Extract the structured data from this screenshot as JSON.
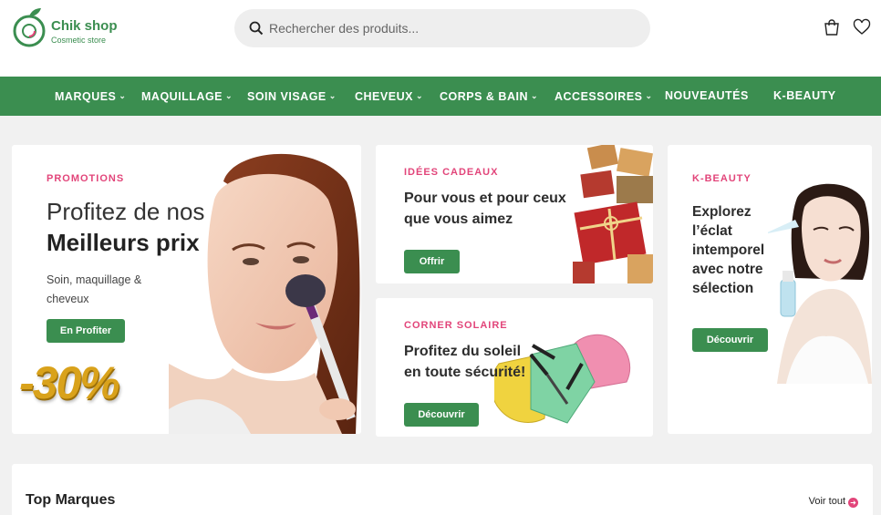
{
  "brand": {
    "name": "Chik shop",
    "tagline": "Cosmetic store"
  },
  "search": {
    "placeholder": "Rechercher des produits..."
  },
  "header_icons": [
    "cart-icon",
    "heart-icon"
  ],
  "nav": {
    "items": [
      {
        "label": "MARQUES",
        "dropdown": true
      },
      {
        "label": "MAQUILLAGE",
        "dropdown": true
      },
      {
        "label": "SOIN VISAGE",
        "dropdown": true
      },
      {
        "label": "CHEVEUX",
        "dropdown": true
      },
      {
        "label": "CORPS & BAIN",
        "dropdown": true
      },
      {
        "label": "ACCESSOIRES",
        "dropdown": true
      },
      {
        "label": "NOUVEAUTÉS",
        "dropdown": false
      },
      {
        "label": "K-BEAUTY",
        "dropdown": false
      }
    ]
  },
  "promo": {
    "eyebrow": "PROMOTIONS",
    "line1": "Profitez de nos",
    "line2": "Meilleurs prix",
    "desc": "Soin, maquillage & cheveux",
    "button": "En Profiter",
    "badge": "-30%"
  },
  "gifts": {
    "eyebrow": "IDÉES CADEAUX",
    "title": "Pour vous et pour ceux que vous aimez",
    "button": "Offrir"
  },
  "sun": {
    "eyebrow": "CORNER SOLAIRE",
    "title": "Profitez du soleil en toute sécurité!",
    "button": "Découvrir"
  },
  "kbeauty": {
    "eyebrow": "K-BEAUTY",
    "title": "Explorez l’éclat intemporel avec notre sélection",
    "button": "Découvrir"
  },
  "top_brands": {
    "title": "Top Marques",
    "link": "Voir tout"
  },
  "colors": {
    "primary": "#3b8e50",
    "accent": "#e2457a"
  }
}
